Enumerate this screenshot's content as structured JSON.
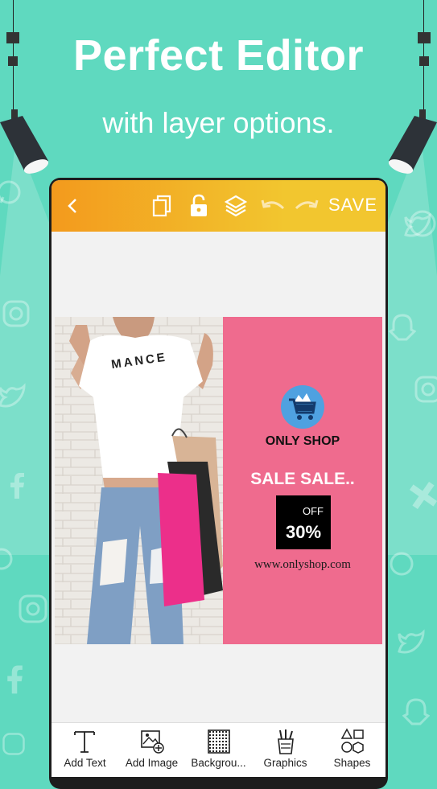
{
  "promo": {
    "headline": "Perfect Editor",
    "subline": "with layer options."
  },
  "toolbar": {
    "icons": [
      "back-arrow-icon",
      "duplicate-icon",
      "unlock-icon",
      "layers-icon",
      "undo-icon",
      "redo-icon"
    ],
    "save_label": "SAVE"
  },
  "design": {
    "shirt_text": "MANCE",
    "shop_name": "ONLY SHOP",
    "sale_text": "SALE SALE..",
    "off_label": "OFF",
    "off_percent": "30%",
    "website": "www.onlyshop.com"
  },
  "bottom_tools": [
    {
      "label": "Add Text",
      "icon": "text-icon"
    },
    {
      "label": "Add Image",
      "icon": "add-image-icon"
    },
    {
      "label": "Backgrou...",
      "icon": "background-icon"
    },
    {
      "label": "Graphics",
      "icon": "graphics-icon"
    },
    {
      "label": "Shapes",
      "icon": "shapes-icon"
    }
  ],
  "colors": {
    "background": "#5fd9bf",
    "toolbar_start": "#f39a1d",
    "toolbar_end": "#f2c62f",
    "pink_panel": "#ef6b8e",
    "logo_blue": "#4fa1e0"
  }
}
